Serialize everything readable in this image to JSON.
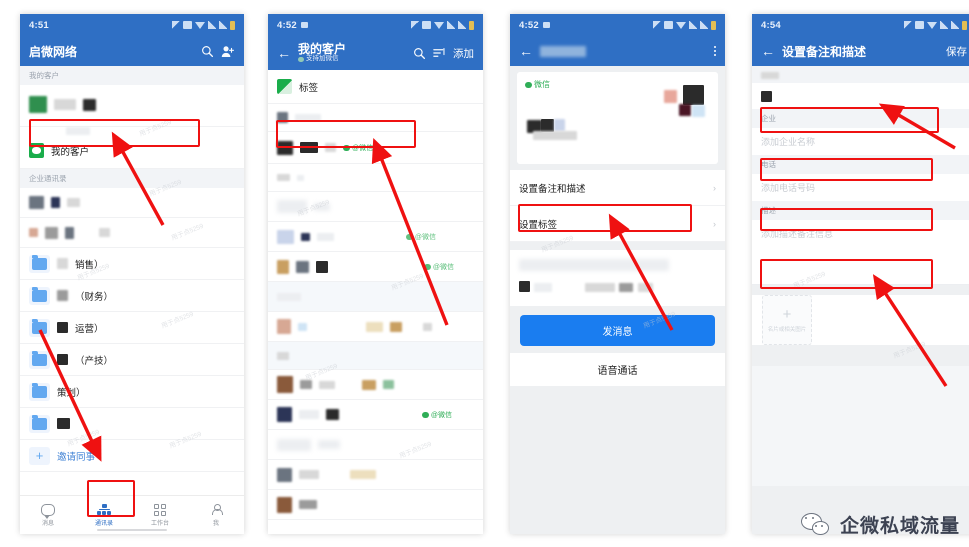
{
  "meta": {
    "brand_text": "企微私域流量"
  },
  "panels": [
    {
      "id": "contacts",
      "status": {
        "time": "4:51"
      },
      "appbar": {
        "title": "启微网络",
        "search_icon": "search-icon",
        "add_user_icon": "add-user-icon"
      },
      "sections": [
        {
          "header": "我的客户"
        },
        {
          "header": "企业通讯录"
        }
      ],
      "my_customer_row": "我的客户",
      "folders": [
        "销售）",
        "（财务）",
        "运营）",
        "（产技）",
        "策划）"
      ],
      "invite": {
        "label": "邀请同事",
        "icon": "plus-icon"
      },
      "tabs": [
        {
          "label": "消息",
          "icon": "chat-icon",
          "active": false
        },
        {
          "label": "通讯录",
          "icon": "org-chart-icon",
          "active": true
        },
        {
          "label": "工作台",
          "icon": "grid-icon",
          "active": false
        },
        {
          "label": "我",
          "icon": "person-icon",
          "active": false
        }
      ]
    },
    {
      "id": "my-customers",
      "status": {
        "time": "4:52"
      },
      "appbar": {
        "title": "我的客户",
        "subtitle": "支持加微信",
        "search_icon": "search-icon",
        "sort_icon": "sort-icon",
        "add_label": "添加"
      },
      "tag_row": "标签",
      "wechat_tag": "@微信"
    },
    {
      "id": "customer-detail",
      "status": {
        "time": "4:52"
      },
      "appbar": {
        "title_redacted": true,
        "more_icon": "more-vertical-icon"
      },
      "card": {
        "source_label": "微信",
        "source_icon": "wechat-icon"
      },
      "menu": [
        {
          "label": "设置备注和描述",
          "chevron": "chevron-right-icon"
        },
        {
          "label": "设置标签",
          "chevron": "chevron-right-icon"
        }
      ],
      "actions": {
        "primary": "发消息",
        "secondary": "语音通话"
      }
    },
    {
      "id": "edit-remark",
      "status": {
        "time": "4:54"
      },
      "appbar": {
        "title": "设置备注和描述",
        "save_label": "保存",
        "back_icon": "back-arrow-icon"
      },
      "fields": [
        {
          "label": "备注",
          "value": "",
          "placeholder": ""
        },
        {
          "label": "企业",
          "value": "",
          "placeholder": "添加企业名称"
        },
        {
          "label": "电话",
          "value": "",
          "placeholder": "添加电话号码"
        },
        {
          "label": "描述",
          "value": "",
          "placeholder": "添加描述备注信息"
        }
      ],
      "upload": {
        "caption": "名片或相关图片",
        "icon": "plus-icon"
      }
    }
  ],
  "colors": {
    "appbar_blue": "#2f6fc4",
    "primary_button": "#1a7df0",
    "highlight_red": "#ef1111",
    "wechat_green": "#2fae57",
    "section_bg": "#f2f4f7"
  },
  "watermark_text": "用于点5259"
}
